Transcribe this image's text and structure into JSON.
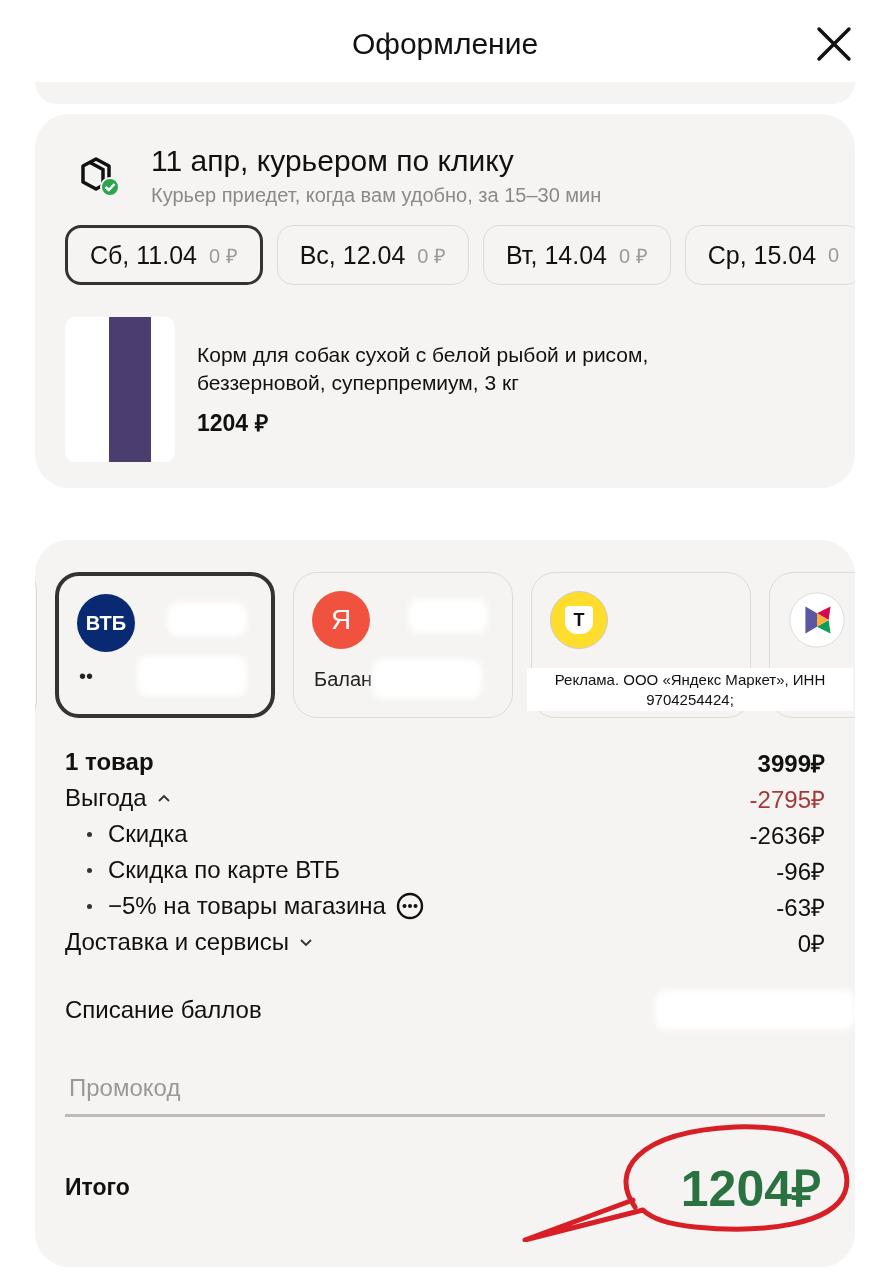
{
  "header": {
    "title": "Оформление"
  },
  "delivery": {
    "title": "11 апр, курьером по клику",
    "subtitle": "Курьер приедет, когда вам удобно, за 15–30 мин",
    "dates": [
      {
        "label": "Сб, 11.04",
        "price": "0 ₽",
        "selected": true
      },
      {
        "label": "Вс, 12.04",
        "price": "0 ₽",
        "selected": false
      },
      {
        "label": "Вт, 14.04",
        "price": "0 ₽",
        "selected": false
      },
      {
        "label": "Ср, 15.04",
        "price": "0",
        "selected": false
      }
    ],
    "product": {
      "name": "Корм для собак сухой с белой рыбой и рисом, беззерновой, суперпремиум, 3 кг",
      "price": "1204 ₽"
    }
  },
  "payment": {
    "methods": [
      {
        "kind": "vtb",
        "logo": "ВТБ",
        "text": "••",
        "selected": true
      },
      {
        "kind": "yandex",
        "logo": "Я",
        "text": "Балан",
        "selected": false
      },
      {
        "kind": "tbank",
        "logo": "Т",
        "selected": false
      },
      {
        "kind": "sbp",
        "selected": false
      }
    ],
    "ad": "Реклама. ООО «Яндекс Маркет», ИНН 9704254424;"
  },
  "summary": [
    {
      "kind": "header",
      "label": "1 товар",
      "value": "3999₽",
      "highlighted": false
    },
    {
      "kind": "toggle",
      "label": "Выгода",
      "value": "-2795₽",
      "highlighted": true,
      "expanded": true
    },
    {
      "kind": "bullet",
      "label": "Скидка",
      "value": "-2636₽",
      "highlighted": false,
      "info": false
    },
    {
      "kind": "bullet",
      "label": "Скидка по карте ВТБ",
      "value": "-96₽",
      "highlighted": false,
      "info": false
    },
    {
      "kind": "bullet",
      "label": "−5% на товары магазина",
      "value": "-63₽",
      "highlighted": false,
      "info": true
    },
    {
      "kind": "toggle",
      "label": "Доставка и сервисы",
      "value": "0₽",
      "highlighted": false,
      "expanded": false
    }
  ],
  "points": {
    "label": "Списание баллов"
  },
  "promo": {
    "placeholder": "Промокод"
  },
  "total": {
    "label": "Итого",
    "value": "1204₽"
  }
}
